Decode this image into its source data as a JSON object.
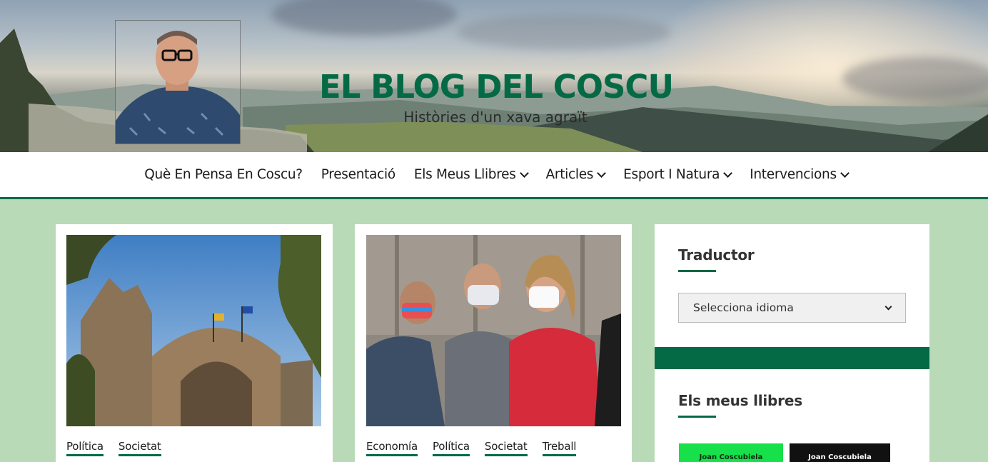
{
  "header": {
    "title": "EL BLOG DEL COSCU",
    "tagline": "Històries d'un xava agraït"
  },
  "nav": {
    "items": [
      {
        "label": "Què En Pensa En Coscu?",
        "has_dropdown": false
      },
      {
        "label": "Presentació",
        "has_dropdown": false
      },
      {
        "label": "Els Meus Llibres",
        "has_dropdown": true
      },
      {
        "label": "Articles",
        "has_dropdown": true
      },
      {
        "label": "Esport I Natura",
        "has_dropdown": true
      },
      {
        "label": "Intervencions",
        "has_dropdown": true
      }
    ]
  },
  "posts": [
    {
      "categories": [
        "Política",
        "Societat"
      ]
    },
    {
      "categories": [
        "Economía",
        "Política",
        "Societat",
        "Treball"
      ]
    }
  ],
  "sidebar": {
    "translator_title": "Traductor",
    "language_select": "Selecciona idioma",
    "books_title": "Els meus llibres",
    "books": [
      {
        "author": "Joan Coscubiela",
        "color": "#18e04a"
      },
      {
        "author": "Joan Coscubiela",
        "color": "#111111"
      }
    ]
  },
  "colors": {
    "accent": "#046a45",
    "page_background": "#b9dab6"
  }
}
